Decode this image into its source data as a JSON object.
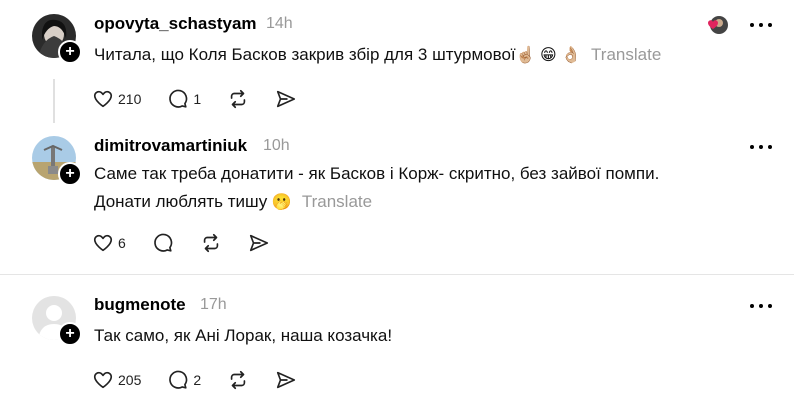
{
  "translate_label": "Translate",
  "posts": [
    {
      "username": "opovyta_schastyam",
      "time": "14h",
      "text_line1": "Читала, що Коля Басков закрив збір для 3 штурмової",
      "emojis": "☝🏼 😁 👌🏼",
      "likes": "210",
      "replies": "1",
      "reposts": "",
      "shares": ""
    },
    {
      "username": "dimitrovamartiniuk",
      "time": "10h",
      "text_line1": "Саме так треба донатити - як Басков і Корж- скритно, без зайвої помпи.",
      "text_line2": "Донати люблять тишу",
      "emojis": "🫢",
      "likes": "6",
      "replies": "",
      "reposts": "",
      "shares": ""
    },
    {
      "username": "bugmenote",
      "time": "17h",
      "text_line1": "Так само, як Ані Лорак, наша козачка!",
      "likes": "205",
      "replies": "2",
      "reposts": "",
      "shares": ""
    }
  ],
  "colors": {
    "muted": "#999999",
    "heart": "#e0245e"
  }
}
